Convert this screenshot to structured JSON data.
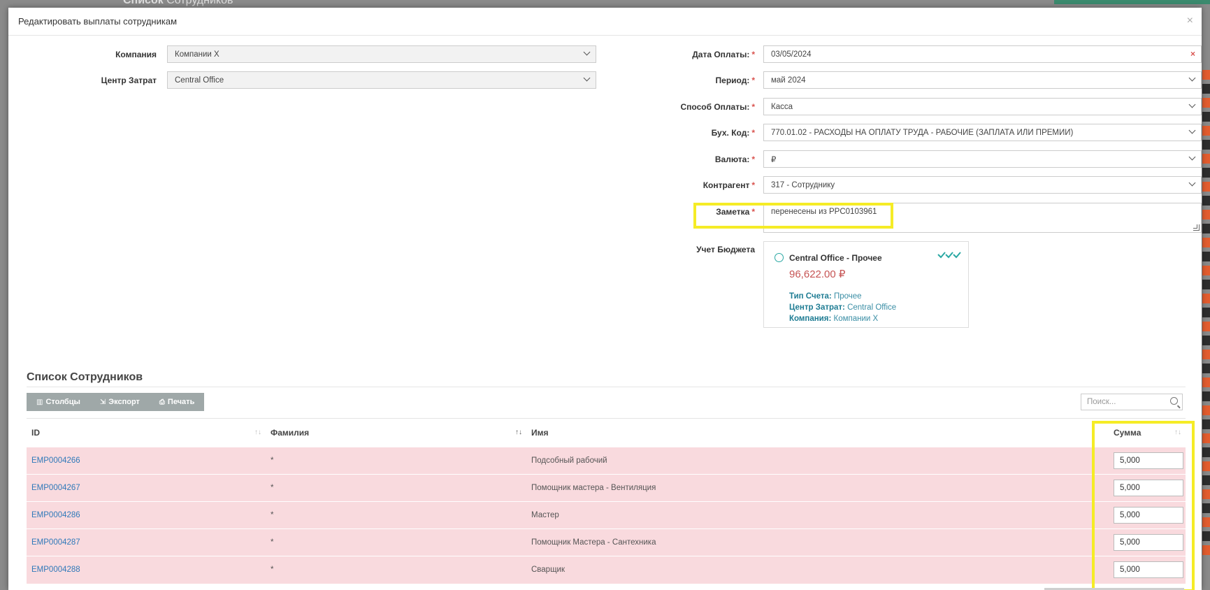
{
  "background": {
    "title_bold": "Список",
    "title_rest": "Сотрудников"
  },
  "modal": {
    "title": "Редактировать выплаты сотрудникам",
    "close_label": "×"
  },
  "left_form": {
    "company_label": "Компания",
    "company_value": "Компании X",
    "cost_center_label": "Центр Затрат",
    "cost_center_value": "Central Office"
  },
  "right_form": {
    "required_mark": "*",
    "pay_date_label": "Дата Оплаты:",
    "pay_date_value": "03/05/2024",
    "clear_label": "×",
    "period_label": "Период:",
    "period_value": "май 2024",
    "payment_method_label": "Способ Оплаты:",
    "payment_method_value": "Касса",
    "acc_code_label": "Бух. Код:",
    "acc_code_value": "770.01.02 - РАСХОДЫ НА ОПЛАТУ ТРУДА - РАБОЧИЕ (ЗАПЛАТА ИЛИ ПРЕМИИ)",
    "currency_label": "Валюта:",
    "currency_value": "₽",
    "counterparty_label": "Контрагент",
    "counterparty_value": "317 - Сотруднику",
    "note_label": "Заметка",
    "note_value": "перенесены из PPC0103961",
    "budget_label": "Учет Бюджета"
  },
  "budget_card": {
    "name": "Central Office - Прочее",
    "amount": "96,622.00 ₽",
    "account_type_label": "Тип Счета:",
    "account_type_value": "Прочее",
    "cost_center_label": "Центр Затрат:",
    "cost_center_value": "Central Office",
    "company_label": "Компания:",
    "company_value": "Компании X",
    "status_icon": "triple-check-icon"
  },
  "employees": {
    "section_title": "Список Сотрудников",
    "toolbar": {
      "columns": "Столбцы",
      "export": "Экспорт",
      "print": "Печать"
    },
    "search_placeholder": "Поиск...",
    "columns": {
      "id": "ID",
      "last_name": "Фамилия",
      "first_name": "Имя",
      "amount": "Сумма"
    },
    "rows": [
      {
        "id": "EMP0004266",
        "last_name": "*",
        "first_name": "Подсобный рабочий",
        "amount": "5,000"
      },
      {
        "id": "EMP0004267",
        "last_name": "*",
        "first_name": "Помощник мастера - Вентиляция",
        "amount": "5,000"
      },
      {
        "id": "EMP0004286",
        "last_name": "*",
        "first_name": "Мастер",
        "amount": "5,000"
      },
      {
        "id": "EMP0004287",
        "last_name": "*",
        "first_name": "Помощник Мастера - Сантехника",
        "amount": "5,000"
      },
      {
        "id": "EMP0004288",
        "last_name": "*",
        "first_name": "Сварщик",
        "amount": "5,000"
      }
    ]
  },
  "colors": {
    "highlight": "#f5ec26",
    "row_bg": "#f9dade",
    "link": "#2f79b9",
    "required": "#d9534f",
    "accent": "#2aa8a3"
  }
}
